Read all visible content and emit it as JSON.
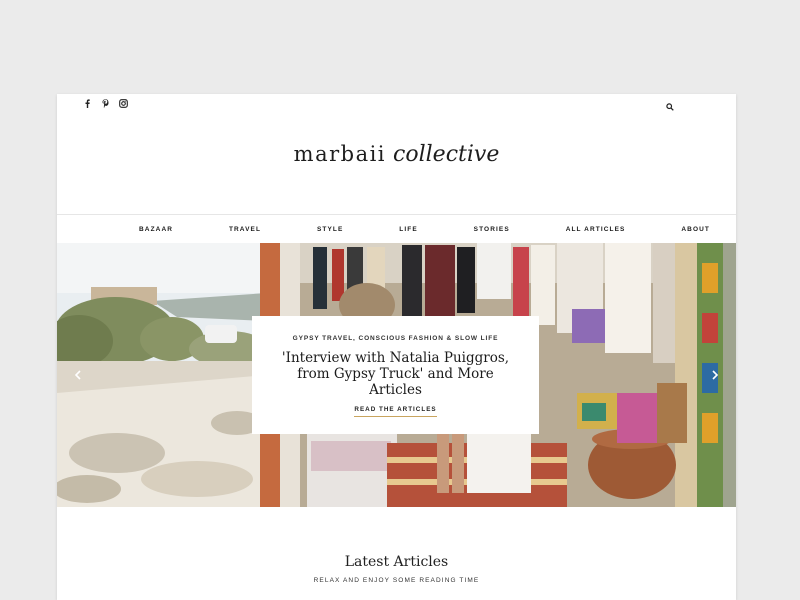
{
  "social": {
    "icons": [
      "facebook-icon",
      "pinterest-icon",
      "instagram-icon"
    ]
  },
  "header": {
    "search_icon": "search-icon",
    "logo_part1": "marbaii",
    "logo_part2": "collective"
  },
  "nav": {
    "items": [
      {
        "label": "BAZAAR"
      },
      {
        "label": "TRAVEL"
      },
      {
        "label": "STYLE"
      },
      {
        "label": "LIFE"
      },
      {
        "label": "STORIES"
      },
      {
        "label": "ALL ARTICLES"
      },
      {
        "label": "ABOUT"
      }
    ]
  },
  "hero": {
    "category": "GYPSY TRAVEL, CONSCIOUS FASHION & SLOW LIFE",
    "title": "'Interview with Natalia Puiggros, from Gypsy Truck' and More Articles",
    "cta": "READ THE ARTICLES",
    "accent_color": "#c9a55f",
    "prev_icon": "chevron-left-icon",
    "next_icon": "chevron-right-icon"
  },
  "latest": {
    "heading": "Latest Articles",
    "subheading": "RELAX AND ENJOY SOME READING TIME"
  }
}
